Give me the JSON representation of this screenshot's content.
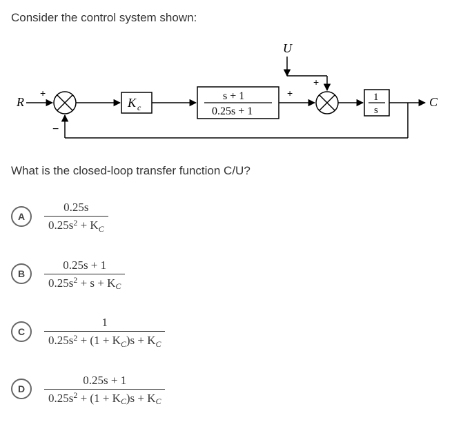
{
  "question": "Consider the control system shown:",
  "subquestion": "What is the closed-loop transfer function C/U?",
  "diagram": {
    "input_label": "R",
    "output_label": "C",
    "disturbance_label": "U",
    "sum1": {
      "plus": "+",
      "minus": "−"
    },
    "controller_label_tex": "K_c",
    "plant_num": "s + 1",
    "plant_den": "0.25s + 1",
    "sum2_plus1": "+",
    "sum2_plus2": "+",
    "integrator_num": "1",
    "integrator_den": "s"
  },
  "options": {
    "A": {
      "letter": "A",
      "num": "0.25s",
      "den_html": "0.25s<span class=\"sup\">2</span> + K<span class=\"sub\">C</span>"
    },
    "B": {
      "letter": "B",
      "num": "0.25s + 1",
      "den_html": "0.25s<span class=\"sup\">2</span> + s + K<span class=\"sub\">C</span>"
    },
    "C": {
      "letter": "C",
      "num": "1",
      "den_html": "0.25s<span class=\"sup\">2</span> + (1 + K<span class=\"sub\">C</span>)s + K<span class=\"sub\">C</span>"
    },
    "D": {
      "letter": "D",
      "num": "0.25s + 1",
      "den_html": "0.25s<span class=\"sup\">2</span> + (1 + K<span class=\"sub\">C</span>)s + K<span class=\"sub\">C</span>"
    }
  }
}
